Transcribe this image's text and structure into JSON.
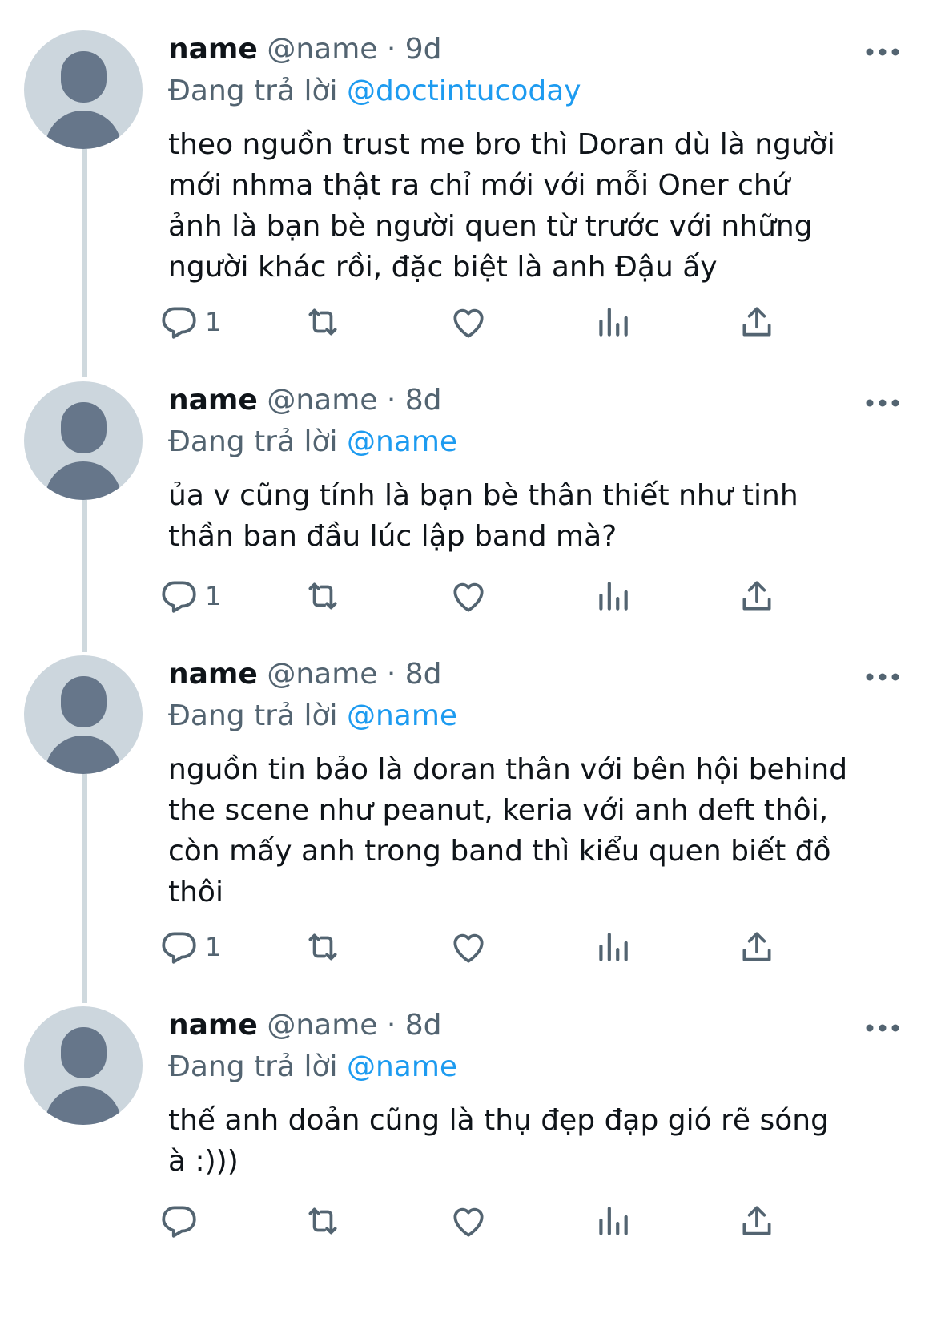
{
  "tweets": [
    {
      "name": "name",
      "handle": "@name",
      "separator": "·",
      "time": "9d",
      "replying_label": "Đang trả lời",
      "replying_to": "@doctintucoday",
      "text": "theo nguồn trust me bro thì Doran dù là người\nmới nhma thật ra chỉ mới với mỗi Oner chứ\nảnh là bạn bè người quen từ trước với những\nngười khác rồi, đặc biệt là anh Đậu  ấy",
      "reply_count": "1"
    },
    {
      "name": "name",
      "handle": "@name",
      "separator": "·",
      "time": "8d",
      "replying_label": "Đang trả lời",
      "replying_to": "@name",
      "text": "ủa v cũng tính là bạn bè thân thiết như tinh\nthần ban đầu lúc lập band mà?",
      "reply_count": "1"
    },
    {
      "name": "name",
      "handle": "@name",
      "separator": "·",
      "time": "8d",
      "replying_label": "Đang trả lời",
      "replying_to": "@name",
      "text": "nguồn tin bảo là doran thân với bên hội behind\nthe scene như peanut, keria với anh deft thôi,\ncòn mấy anh trong band thì kiểu quen biết đồ\nthôi",
      "reply_count": "1"
    },
    {
      "name": "name",
      "handle": "@name",
      "separator": "·",
      "time": "8d",
      "replying_label": "Đang trả lời",
      "replying_to": "@name",
      "text": "thế anh doản cũng là thụ đẹp đạp gió rẽ sóng\nà :)))",
      "reply_count": ""
    }
  ],
  "icons": {
    "reply": "reply-icon",
    "retweet": "retweet-icon",
    "like": "like-icon",
    "views": "views-icon",
    "share": "share-icon",
    "more": "more-icon"
  },
  "colors": {
    "text": "#0f1419",
    "secondary": "#536471",
    "link": "#1d9bf0",
    "avatar_bg": "#ccd6dd",
    "avatar_fg": "#66768a",
    "thread_line": "#cfd9de"
  }
}
